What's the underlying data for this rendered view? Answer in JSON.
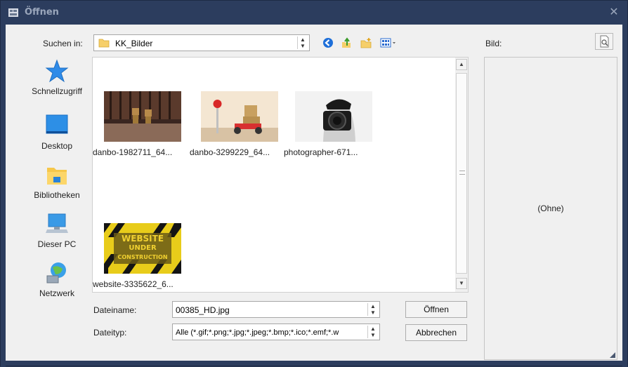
{
  "window": {
    "title": "Öffnen",
    "close_glyph": "✕"
  },
  "toolbar": {
    "look_in_label": "Suchen in:",
    "look_in_value": "KK_Bilder",
    "icons": [
      "back-icon",
      "up-folder-icon",
      "new-folder-icon",
      "view-menu-icon"
    ],
    "preview_label": "Bild:"
  },
  "places": [
    {
      "label": "Schnellzugriff",
      "icon": "quick-access-star-icon"
    },
    {
      "label": "Desktop",
      "icon": "desktop-icon"
    },
    {
      "label": "Bibliotheken",
      "icon": "libraries-icon"
    },
    {
      "label": "Dieser PC",
      "icon": "this-pc-icon"
    },
    {
      "label": "Netzwerk",
      "icon": "network-icon"
    }
  ],
  "files": [
    {
      "label": "danbo-1982711_64..."
    },
    {
      "label": "danbo-3299229_64..."
    },
    {
      "label": "photographer-671..."
    },
    {
      "label": "website-3335622_6..."
    }
  ],
  "thumb_text": {
    "line1": "WEBSITE",
    "line2": "UNDER",
    "line3": "CONSTRUCTION"
  },
  "form": {
    "filename_label": "Dateiname:",
    "filename_value": "00385_HD.jpg",
    "filetype_label": "Dateityp:",
    "filetype_value": "Alle (*.gif;*.png;*.jpg;*.jpeg;*.bmp;*.ico;*.emf;*.w",
    "open_label": "Öffnen",
    "cancel_label": "Abbrechen"
  },
  "preview": {
    "empty_text": "(Ohne)"
  },
  "colors": {
    "titlebar": "#2c3d5e",
    "accent": "#1e6fd9"
  }
}
